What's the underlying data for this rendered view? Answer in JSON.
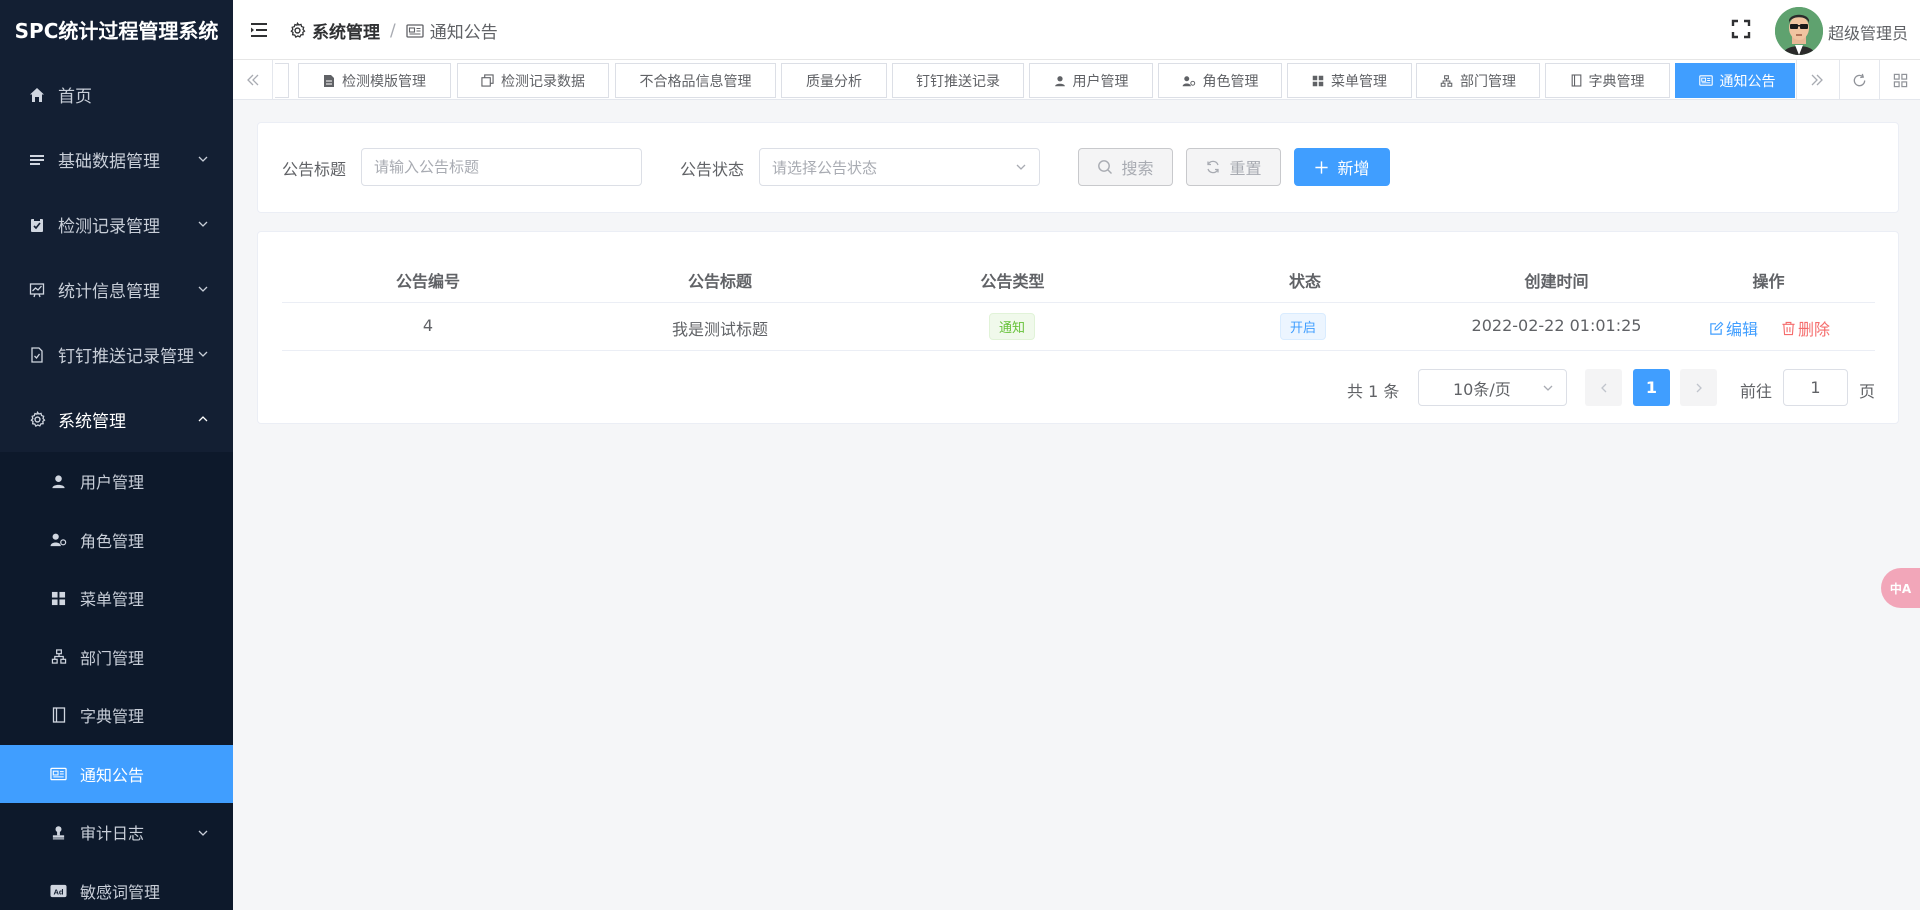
{
  "app": {
    "title": "SPC统计过程管理系统"
  },
  "sidebar": {
    "items": [
      {
        "label": "首页",
        "icon": "home-icon"
      },
      {
        "label": "基础数据管理",
        "icon": "list-icon"
      },
      {
        "label": "检测记录管理",
        "icon": "clipboard-check-icon"
      },
      {
        "label": "统计信息管理",
        "icon": "chart-icon"
      },
      {
        "label": "钉钉推送记录管理",
        "icon": "document-check-icon"
      },
      {
        "label": "系统管理",
        "icon": "gear-icon"
      }
    ],
    "system_sub": [
      {
        "label": "用户管理",
        "icon": "user-icon"
      },
      {
        "label": "角色管理",
        "icon": "role-icon"
      },
      {
        "label": "菜单管理",
        "icon": "grid-icon"
      },
      {
        "label": "部门管理",
        "icon": "tree-icon"
      },
      {
        "label": "字典管理",
        "icon": "book-icon"
      },
      {
        "label": "通知公告",
        "icon": "notice-icon"
      },
      {
        "label": "审计日志",
        "icon": "stamp-icon"
      },
      {
        "label": "敏感词管理",
        "icon": "ad-icon"
      }
    ],
    "active_color": "#409eff"
  },
  "header": {
    "breadcrumb": [
      "系统管理",
      "通知公告"
    ],
    "breadcrumb_sep": "/",
    "username": "超级管理员"
  },
  "tabs": [
    {
      "label": "检测模版管理"
    },
    {
      "label": "检测记录数据"
    },
    {
      "label": "不合格品信息管理"
    },
    {
      "label": "质量分析"
    },
    {
      "label": "钉钉推送记录"
    },
    {
      "label": "用户管理"
    },
    {
      "label": "角色管理"
    },
    {
      "label": "菜单管理"
    },
    {
      "label": "部门管理"
    },
    {
      "label": "字典管理"
    },
    {
      "label": "通知公告",
      "active": true
    }
  ],
  "search": {
    "title_label": "公告标题",
    "title_placeholder": "请输入公告标题",
    "status_label": "公告状态",
    "status_placeholder": "请选择公告状态",
    "search_btn": "搜索",
    "reset_btn": "重置",
    "add_btn": "新增"
  },
  "table": {
    "columns": [
      "公告编号",
      "公告标题",
      "公告类型",
      "状态",
      "创建时间",
      "操作"
    ],
    "rows": [
      {
        "id": "4",
        "title": "我是测试标题",
        "type": "通知",
        "status": "开启",
        "created": "2022-02-22 01:01:25",
        "edit": "编辑",
        "delete": "删除"
      }
    ]
  },
  "pagination": {
    "total": "共 1 条",
    "page_size": "10条/页",
    "current": "1",
    "goto_label": "前往",
    "goto_value": "1",
    "page_suffix": "页"
  },
  "float": {
    "label": "中A"
  }
}
